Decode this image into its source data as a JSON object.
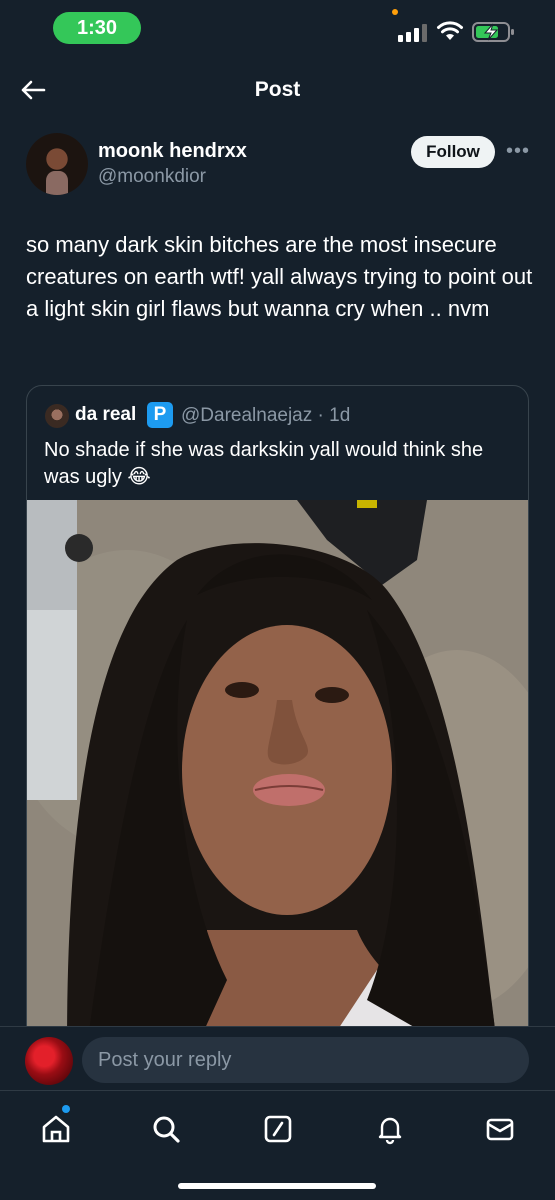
{
  "status_bar": {
    "time": "1:30"
  },
  "header": {
    "title": "Post"
  },
  "post": {
    "author": {
      "display_name": "moonk hendrxx",
      "handle": "@moonkdior"
    },
    "follow_label": "Follow",
    "more_label": "•••",
    "text": "so many dark skin bitches are the most insecure creatures on earth wtf! yall always trying to point out a light skin girl flaws but wanna cry when .. nvm"
  },
  "quote": {
    "author": {
      "display_name": "da real",
      "badge": "P",
      "handle_time": "@Darealnaejaz · 1d"
    },
    "text": "No shade if she was darkskin yall would think she was ugly 😂"
  },
  "reply": {
    "placeholder": "Post your reply"
  },
  "tabs": [
    {
      "icon": "home-icon",
      "has_notification_dot": true
    },
    {
      "icon": "search-icon"
    },
    {
      "icon": "grok-icon"
    },
    {
      "icon": "notifications-icon"
    },
    {
      "icon": "messages-icon"
    }
  ],
  "colors": {
    "background": "#15202b",
    "accent": "#1d9bf0",
    "secondary_text": "#8b98a5",
    "status_time_pill": "#34c759"
  }
}
